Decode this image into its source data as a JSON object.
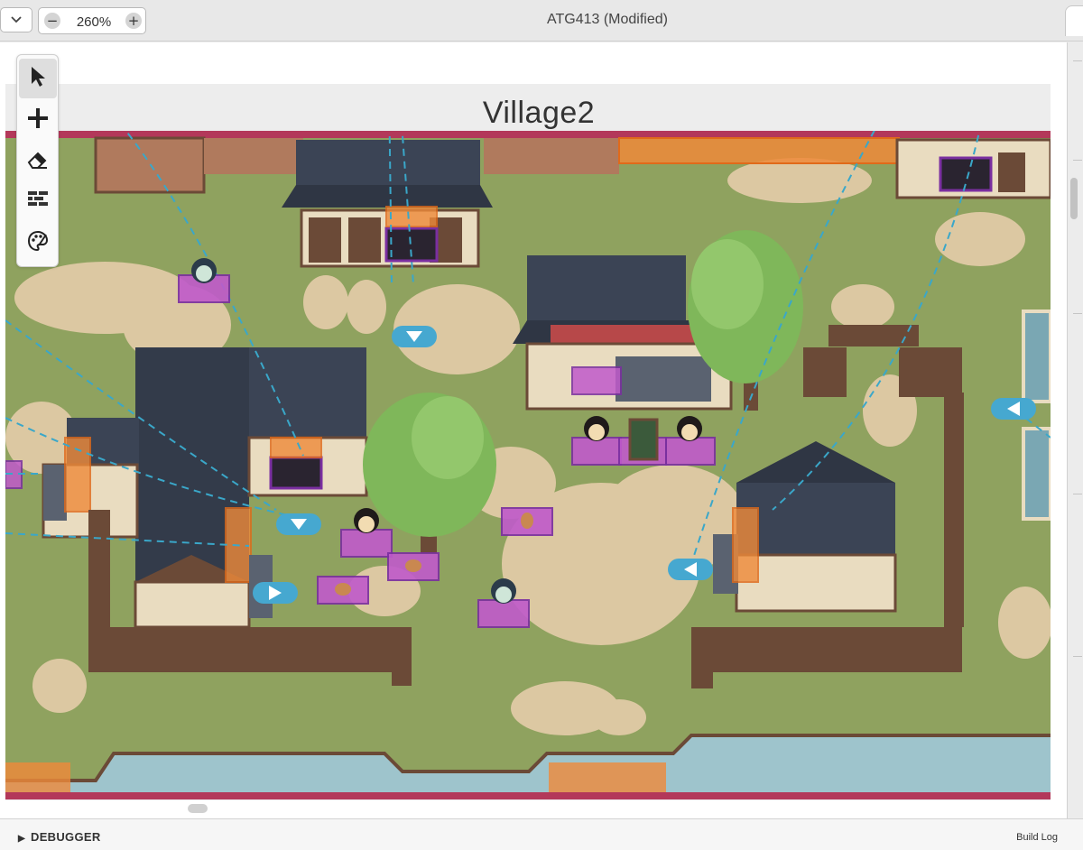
{
  "window": {
    "title": "ATG413 (Modified)",
    "view_dropdown_icon": "chevron-down-icon"
  },
  "zoom": {
    "value": "260%",
    "minus": "−",
    "plus": "+"
  },
  "tools": [
    {
      "name": "select",
      "icon": "cursor-icon",
      "active": true
    },
    {
      "name": "add",
      "icon": "plus-icon",
      "active": false
    },
    {
      "name": "eraser",
      "icon": "eraser-icon",
      "active": false
    },
    {
      "name": "collisions",
      "icon": "brick-icon",
      "active": false
    },
    {
      "name": "colors",
      "icon": "palette-icon",
      "active": false
    }
  ],
  "scene": {
    "name": "Village2"
  },
  "bottom": {
    "debugger_label": "DEBUGGER",
    "build_log_label": "Build Log"
  },
  "colors": {
    "grass": "#8fa25f",
    "sand": "#dcc8a2",
    "water": "#9ec4cc",
    "actor_box": "#c05acb",
    "trigger_box": "#ef8a3a",
    "connection_line": "#3aa7c9",
    "scene_border": "#b3385a",
    "roof": "#3b4455",
    "wall": "#e9dcc0",
    "wood": "#6b4a37",
    "tree": "#7fb75a"
  }
}
